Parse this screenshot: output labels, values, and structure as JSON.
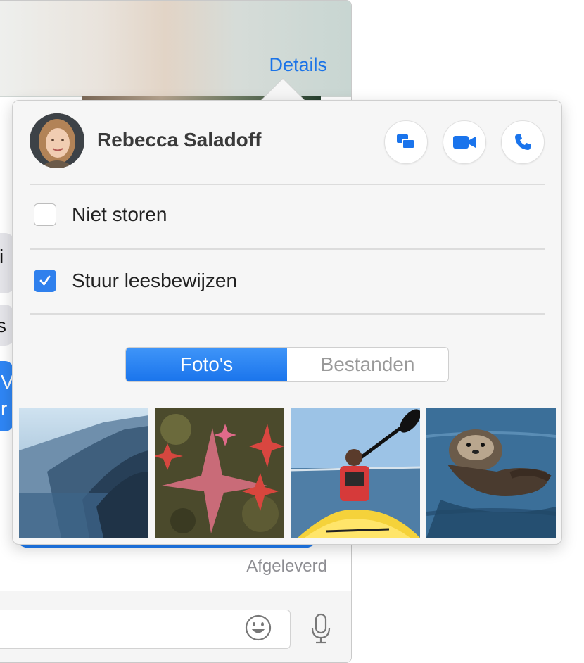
{
  "window": {
    "details_link": "Details",
    "fragments": [
      "i",
      "s",
      "V",
      "r"
    ],
    "delivered_status": "Afgeleverd",
    "emoji_icon": "emoji-icon",
    "mic_icon": "microphone-icon"
  },
  "popover": {
    "contact": {
      "name": "Rebecca Saladoff"
    },
    "actions": [
      {
        "icon": "message-bubbles-icon"
      },
      {
        "icon": "video-camera-icon"
      },
      {
        "icon": "phone-icon"
      }
    ],
    "options": [
      {
        "label": "Niet storen",
        "checked": false
      },
      {
        "label": "Stuur leesbewijzen",
        "checked": true
      }
    ],
    "tabs": [
      {
        "label": "Foto's",
        "active": true
      },
      {
        "label": "Bestanden",
        "active": false
      }
    ],
    "photos": [
      {
        "subject": "coast-cliffs"
      },
      {
        "subject": "starfish"
      },
      {
        "subject": "kayak"
      },
      {
        "subject": "sea-otter"
      }
    ],
    "colors": {
      "accent": "#1a74ec",
      "link": "#1a73e8",
      "checkbox_on": "#2f80ed"
    }
  }
}
